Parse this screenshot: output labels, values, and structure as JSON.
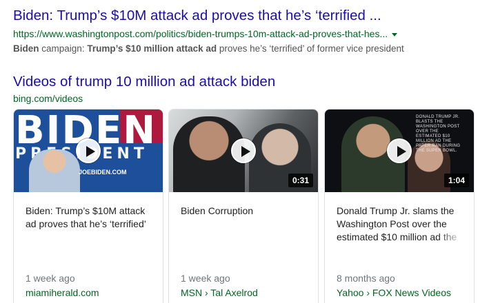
{
  "result1": {
    "title": "Biden: Trump’s $10M attack ad proves that he’s ‘terrified ...",
    "url": "https://www.washingtonpost.com/politics/biden-trumps-10m-attack-ad-proves-that-hes...",
    "snippet": {
      "part1": "Biden",
      "part2": " campaign: ",
      "part3": "Trump’s $10 million attack ad",
      "part4": " proves he’s ‘terrified’ of former vice president"
    }
  },
  "videos": {
    "heading": "Videos of trump 10 million ad attack biden",
    "source": "bing.com/videos",
    "cards": [
      {
        "title": "Biden: Trump’s $10M attack ad proves that he’s ‘terrified’",
        "age": "1 week ago",
        "source": "miamiherald.com",
        "thumb_text": {
          "big": "BIDEN",
          "sub": "PRESIDENT",
          "url": "JOEBIDEN.COM"
        }
      },
      {
        "title": "Biden Corruption",
        "age": "1 week ago",
        "source": "MSN › Tal Axelrod",
        "duration": "0:31"
      },
      {
        "title": "Donald Trump Jr. slams the Washington Post over the estimated $10 million ad the",
        "age": "8 months ago",
        "source": "Yahoo › FOX News Videos",
        "duration": "1:04",
        "thumb_text": "Donald Trump Jr. blasts the Washington Post over the estimated $10 million ad the paper ran during the Super Bowl."
      }
    ]
  },
  "colors": {
    "link": "#1a0dab",
    "url_green": "#006621",
    "snippet_gray": "#545454"
  },
  "icons": [
    "play-icon",
    "dropdown-caret-icon"
  ]
}
